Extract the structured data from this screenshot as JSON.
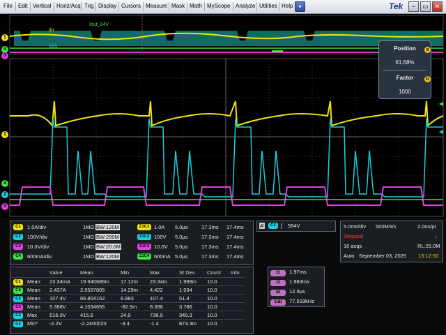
{
  "menu": [
    "File",
    "Edit",
    "Vertical",
    "Horiz/Acq",
    "Trig",
    "Display",
    "Cursors",
    "Measure",
    "Mask",
    "Math",
    "MyScope",
    "Analyze",
    "Utilities",
    "Help"
  ],
  "brand": "Tek",
  "dropdown_glyph": "▾",
  "window_buttons": {
    "minimize": "−",
    "restore": "▭",
    "close": "✕"
  },
  "waveform_labels": {
    "iin": "Iin",
    "iout": "Iout_24V",
    "vds": "Vds"
  },
  "zoom_panel": {
    "position_label": "Position",
    "position_value": "61.68%",
    "factor_label": "Factor",
    "factor_value": "1000",
    "knob_a": "a",
    "knob_b": "b"
  },
  "channel_markers": {
    "c1": "1",
    "c2": "2",
    "c3": "3",
    "c4": "4"
  },
  "colors": {
    "c1": "#f2e40a",
    "c2": "#18d0e0",
    "c3": "#e040e0",
    "c4": "#3fe04a",
    "zoom_region": "#19a59a"
  },
  "channels": [
    {
      "badge": "C1",
      "scale": "1.0A/div",
      "imp": "1MΩ",
      "bw": "BW:120M",
      "zbadge": "Z1C1",
      "zscale": "1.0A",
      "ztime": "5.0μs",
      "zpos": "17.3ms",
      "zend": "17.4ms"
    },
    {
      "badge": "C2",
      "scale": "100V/div",
      "imp": "1MΩ",
      "bw": "BW:200M",
      "zbadge": "Z1C2",
      "zscale": "100V",
      "ztime": "5.0μs",
      "zpos": "17.3ms",
      "zend": "17.4ms"
    },
    {
      "badge": "C3",
      "scale": "10.0V/div",
      "imp": "1MΩ",
      "bw": "BW:20.0M",
      "zbadge": "Z1C3",
      "zscale": "10.0V",
      "ztime": "5.0μs",
      "zpos": "17.3ms",
      "zend": "17.4ms"
    },
    {
      "badge": "C4",
      "scale": "600mA/div",
      "imp": "1MΩ",
      "bw": "BW:120M",
      "zbadge": "Z1C4",
      "zscale": "600mA",
      "ztime": "5.0μs",
      "zpos": "17.3ms",
      "zend": "17.4ms"
    }
  ],
  "trigger": {
    "mode": "A'",
    "badge": "C2",
    "slope": "∫",
    "level": "584V"
  },
  "acq": {
    "timebase": "5.0ms/div",
    "rate": "500MS/s",
    "spp": "2.0ns/pt",
    "state": "Stopped",
    "acqs": "10 acqs",
    "rl": "RL:25.0M",
    "mode": "Auto",
    "date": "September 03, 2025",
    "time": "13:12:50"
  },
  "meas_headers": [
    "",
    "",
    "Value",
    "Mean",
    "Min",
    "Max",
    "St Dev",
    "Count",
    "Info"
  ],
  "measurements": [
    {
      "badge": "C1",
      "name": "Mean",
      "value": "23.34mA",
      "mean": "19.940689m",
      "min": "17.12m",
      "max": "23.34m",
      "stdev": "1.999m",
      "count": "10.0"
    },
    {
      "badge": "C4",
      "name": "Mean",
      "value": "2.437A",
      "mean": "2.0597805",
      "min": "14.29m",
      "max": "4.422",
      "stdev": "1.934",
      "count": "10.0"
    },
    {
      "badge": "C2",
      "name": "Mean",
      "value": "107.4V",
      "mean": "66.804152",
      "min": "6.983",
      "max": "107.4",
      "stdev": "51.4",
      "count": "10.0"
    },
    {
      "badge": "C3",
      "name": "Mean",
      "value": "5.388V",
      "mean": "4.1034655",
      "min": "-82.9m",
      "max": "8.396",
      "stdev": "3.786",
      "count": "10.0"
    },
    {
      "badge": "C2",
      "name": "Max",
      "value": "616.0V",
      "mean": "415.6",
      "min": "24.0",
      "max": "736.0",
      "stdev": "340.3",
      "count": "10.0"
    },
    {
      "badge": "C2",
      "name": "Min*",
      "value": "-2.2V",
      "mean": "-2.2400023",
      "min": "-3.4",
      "max": "-1.4",
      "stdev": "873.3m",
      "count": "10.0"
    }
  ],
  "cursors": [
    {
      "badge": "t1",
      "value": "1.97ms"
    },
    {
      "badge": "t2",
      "value": "1.983ms"
    },
    {
      "badge": "Δt",
      "value": "12.9μs"
    },
    {
      "badge": "1/Δt",
      "value": "77.519kHz"
    }
  ]
}
